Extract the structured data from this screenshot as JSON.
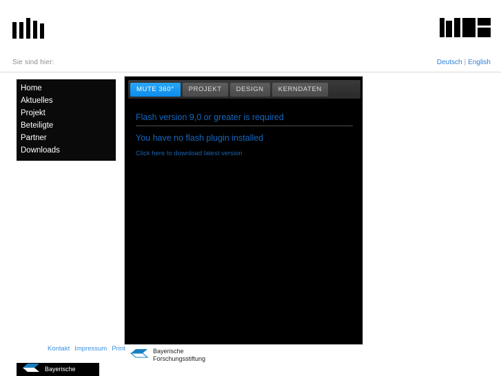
{
  "header": {
    "logo_left_name": "mute-bars-logo",
    "logo_right_name": "mute-blocks-logo",
    "logo_right_alt": "MUTE"
  },
  "breadcrumb": {
    "label": "Sie sind hier:"
  },
  "language": {
    "german": "Deutsch",
    "separator": "|",
    "english": "English"
  },
  "sidebar": {
    "items": [
      {
        "label": "Home"
      },
      {
        "label": "Aktuelles"
      },
      {
        "label": "Projekt"
      },
      {
        "label": "Beteiligte"
      },
      {
        "label": "Partner"
      },
      {
        "label": "Downloads"
      }
    ]
  },
  "main": {
    "tabs": [
      {
        "label": "MUTE 360°",
        "active": true
      },
      {
        "label": "PROJEKT",
        "active": false
      },
      {
        "label": "DESIGN",
        "active": false
      },
      {
        "label": "KERNDATEN",
        "active": false
      }
    ],
    "flash": {
      "title": "Flash version 9,0 or greater is required",
      "subtitle": "You have no flash plugin installed",
      "link": "Click here to download latest version"
    }
  },
  "footer": {
    "links": [
      {
        "label": "Kontakt"
      },
      {
        "label": "Impressum"
      },
      {
        "label": "Print"
      }
    ],
    "sponsor": {
      "line1": "Bayerische",
      "line2": "Forschungsstiftung",
      "logo_name": "bayerische-forschungsstiftung-logo"
    },
    "sponsor_dark": {
      "line1": "Bayerische",
      "logo_name": "bayerische-forschungsstiftung-logo-dark"
    }
  },
  "colors": {
    "accent_blue": "#0d8cec",
    "link_blue": "#2f7fd6",
    "panel_black": "#000000",
    "sponsor_blue": "#1a7fc1"
  }
}
